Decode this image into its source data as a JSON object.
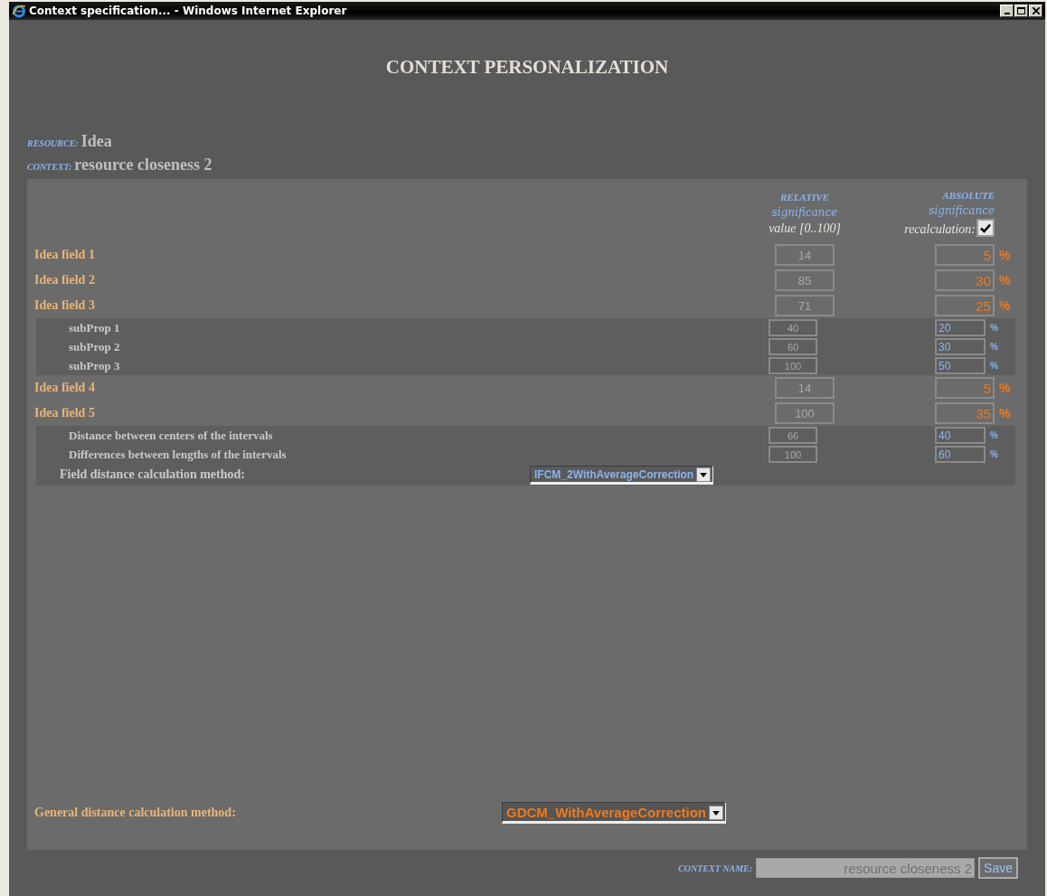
{
  "window": {
    "title": "Context specification... - Windows Internet Explorer"
  },
  "heading": "CONTEXT PERSONALIZATION",
  "resource": {
    "label": "RESOURCE:",
    "value": "Idea"
  },
  "context": {
    "label": "CONTEXT:",
    "value": "resource closeness 2"
  },
  "columns": {
    "relative": [
      "RELATIVE",
      "significance",
      "value [0..100]"
    ],
    "absolute": [
      "ABSOLUTE",
      "significance"
    ],
    "recalculation": {
      "label": "recalculation:",
      "checked": true
    }
  },
  "fields": [
    {
      "label": "Idea field 1",
      "relative": "14",
      "absolute": "5",
      "unit": "%"
    },
    {
      "label": "Idea field 2",
      "relative": "85",
      "absolute": "30",
      "unit": "%"
    },
    {
      "label": "Idea field 3",
      "relative": "71",
      "absolute": "25",
      "unit": "%",
      "children": [
        {
          "label": "subProp 1",
          "relative": "40",
          "absolute": "20",
          "unit": "%"
        },
        {
          "label": "subProp 2",
          "relative": "60",
          "absolute": "30",
          "unit": "%"
        },
        {
          "label": "subProp 3",
          "relative": "100",
          "absolute": "50",
          "unit": "%"
        }
      ]
    },
    {
      "label": "Idea field 4",
      "relative": "14",
      "absolute": "5",
      "unit": "%"
    },
    {
      "label": "Idea field 5",
      "relative": "100",
      "absolute": "35",
      "unit": "%",
      "children": [
        {
          "label": "Distance between centers of the intervals",
          "relative": "66",
          "absolute": "40",
          "unit": "%"
        },
        {
          "label": "Differences between lengths of the intervals",
          "relative": "100",
          "absolute": "60",
          "unit": "%"
        }
      ],
      "method": {
        "label": "Field distance calculation method:",
        "value": "IFCM_2WithAverageCorrection"
      }
    }
  ],
  "general": {
    "label": "General distance calculation method:",
    "value": "GDCM_WithAverageCorrection"
  },
  "footer": {
    "label": "CONTEXT NAME:",
    "value": "resource closeness 2",
    "button": "Save"
  }
}
